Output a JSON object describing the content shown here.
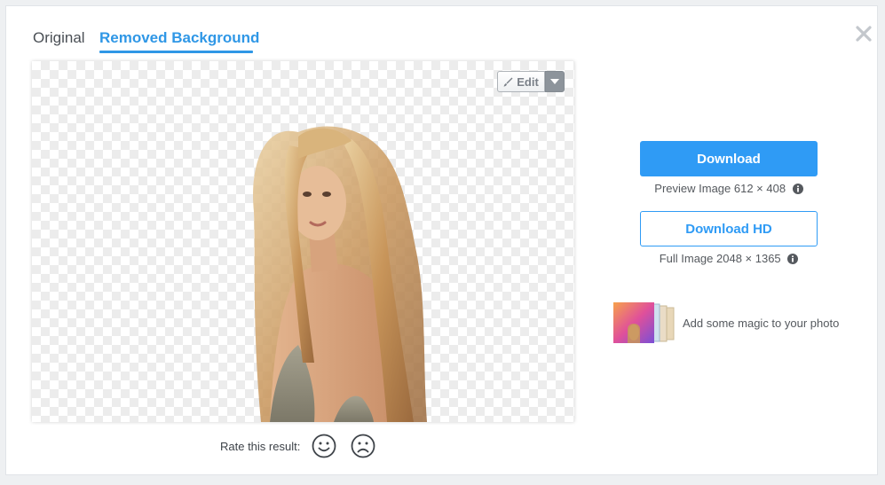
{
  "tabs": [
    {
      "label": "Original",
      "active": false
    },
    {
      "label": "Removed Background",
      "active": true
    }
  ],
  "editor": {
    "edit_label": "Edit"
  },
  "rating": {
    "label": "Rate this result:"
  },
  "downloads": {
    "download_label": "Download",
    "preview_info": "Preview Image 612 × 408",
    "download_hd_label": "Download HD",
    "full_info": "Full Image 2048 × 1365"
  },
  "magic": {
    "label": "Add some magic to your photo"
  },
  "colors": {
    "accent": "#2f9bf5",
    "tab_active": "#2f97e6",
    "checker": "#ececec"
  },
  "icons": {
    "close": "close-icon",
    "edit": "brush-icon",
    "caret": "caret-down-icon",
    "info": "info-icon",
    "happy": "smile-face-icon",
    "sad": "sad-face-icon"
  }
}
